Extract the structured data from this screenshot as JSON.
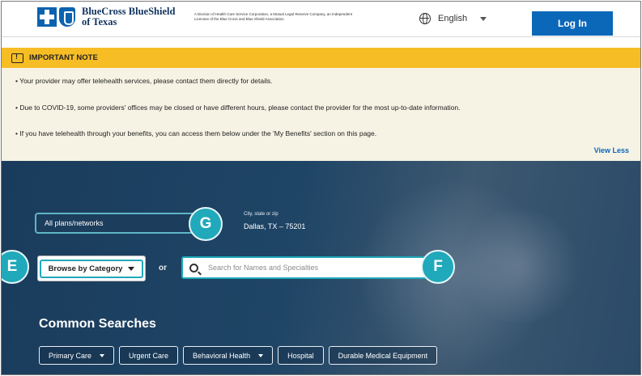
{
  "header": {
    "brand_line1": "BlueCross BlueShield",
    "brand_line2": "of Texas",
    "brand_sub": "A Division of Health Care Service Corporation, a Mutual Legal Reserve Company, an Independent Licensee of the Blue Cross and Blue Shield Association",
    "language": "English",
    "login_label": "Log In"
  },
  "note": {
    "title": "IMPORTANT NOTE",
    "lines": [
      "• Your provider may offer telehealth services, please contact them directly for details.",
      "• Due to COVID-19, some providers' offices may be closed or have different hours, please contact the provider for the most up-to-date information.",
      "• If you have telehealth through your benefits, you can access them below under the 'My Benefits' section on this page."
    ],
    "toggle_label": "View Less"
  },
  "search": {
    "plans_label": "All plans/networks",
    "location_label": "City, state or zip",
    "location_value": "Dallas, TX – 75201",
    "browse_label": "Browse by Category",
    "or_label": "or",
    "placeholder": "Search for Names and Specialties"
  },
  "callouts": {
    "g": "G",
    "e": "E",
    "f": "F"
  },
  "common": {
    "title": "Common Searches",
    "chips": [
      {
        "label": "Primary Care",
        "has_dropdown": true
      },
      {
        "label": "Urgent Care",
        "has_dropdown": false
      },
      {
        "label": "Behavioral Health",
        "has_dropdown": true
      },
      {
        "label": "Hospital",
        "has_dropdown": false
      },
      {
        "label": "Durable Medical Equipment",
        "has_dropdown": false
      }
    ]
  },
  "colors": {
    "brand_blue": "#0b67b8",
    "note_yellow": "#f6bd25",
    "callout_teal": "#20a9ba",
    "hero_navy": "#1f4566"
  }
}
